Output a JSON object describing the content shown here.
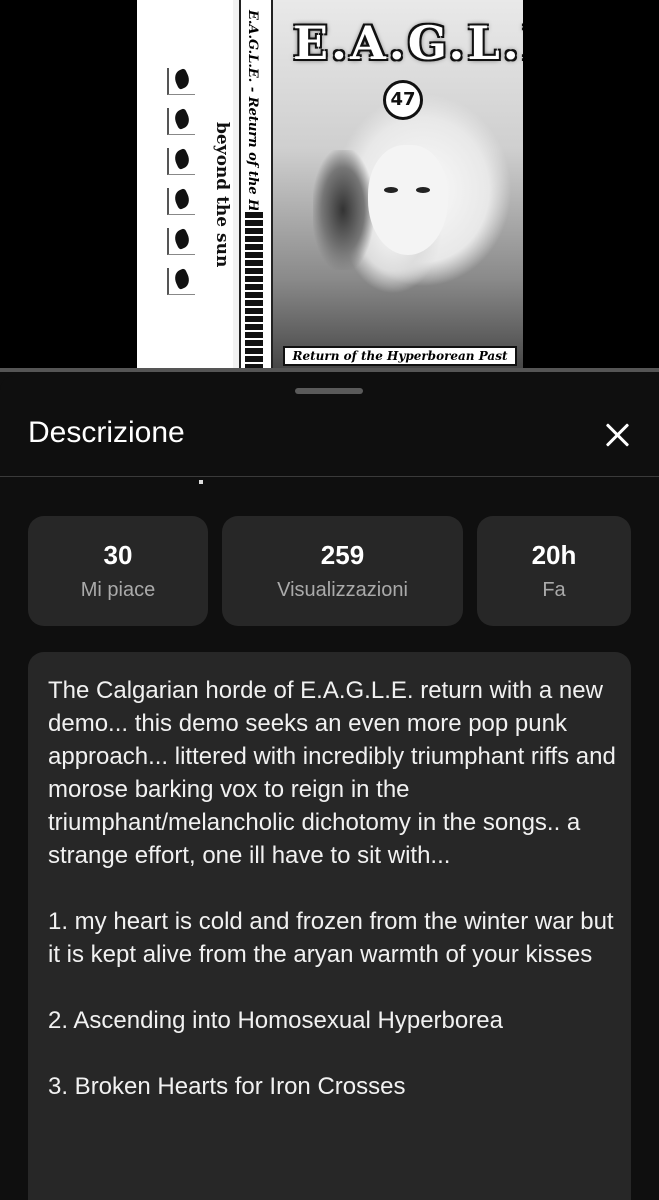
{
  "cover": {
    "side_text": "beyond the sun",
    "spine_text": "E.A.G.L.E. - Return of the Hyperborean Past",
    "logo_text": "E.A.G.L.E.",
    "emblem_text": "47",
    "caption": "Return of the Hyperborean Past"
  },
  "sheet": {
    "title": "Descrizione"
  },
  "stats": [
    {
      "value": "30",
      "label": "Mi piace"
    },
    {
      "value": "259",
      "label": "Visualizzazioni"
    },
    {
      "value": "20h",
      "label": "Fa"
    }
  ],
  "description": {
    "text": "The Calgarian horde of E.A.G.L.E. return with a new demo... this demo seeks an even more pop punk approach... littered with incredibly triumphant riffs and morose barking vox to reign in the triumphant/melancholic dichotomy in the songs.. a strange effort, one ill have to sit with...\n\n1. my heart is cold and frozen from the winter war but it is kept alive from the aryan warmth of your kisses\n\n2. Ascending into Homosexual Hyperborea\n\n3. Broken Hearts for Iron Crosses"
  }
}
